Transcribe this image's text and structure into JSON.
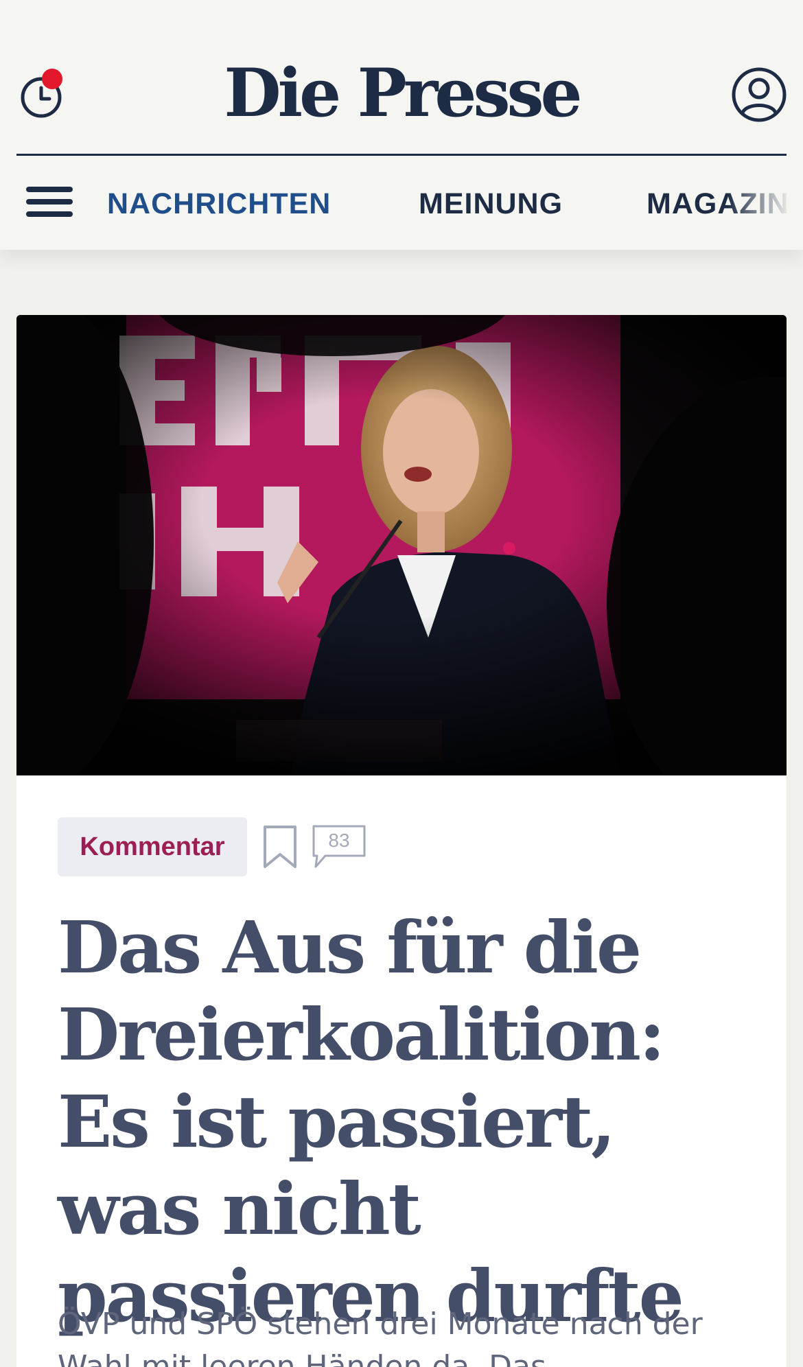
{
  "header": {
    "logo": "Die Presse",
    "history_icon": "clock-icon",
    "notification_color": "#e3182d",
    "account_icon": "user-circle-icon"
  },
  "nav": {
    "menu_icon": "hamburger-menu-icon",
    "items": [
      {
        "label": "NACHRICHTEN",
        "active": true
      },
      {
        "label": "MEINUNG",
        "active": false
      },
      {
        "label": "MAGAZIN",
        "active": false
      }
    ]
  },
  "article": {
    "tag": "Kommentar",
    "comment_count": "83",
    "headline": "Das Aus für die Dreierkoalition: Es ist passiert, was nicht passieren durfte",
    "lead": "ÖVP und SPÖ stehen drei Monate nach der Wahl mit leeren Händen da. Das"
  },
  "colors": {
    "brand_navy": "#1d2b44",
    "active_nav": "#1f4e8a",
    "tag_text": "#9b1f55",
    "tag_background": "#ecedf3",
    "headline": "#454e68",
    "page_background": "#f5f5f1"
  }
}
